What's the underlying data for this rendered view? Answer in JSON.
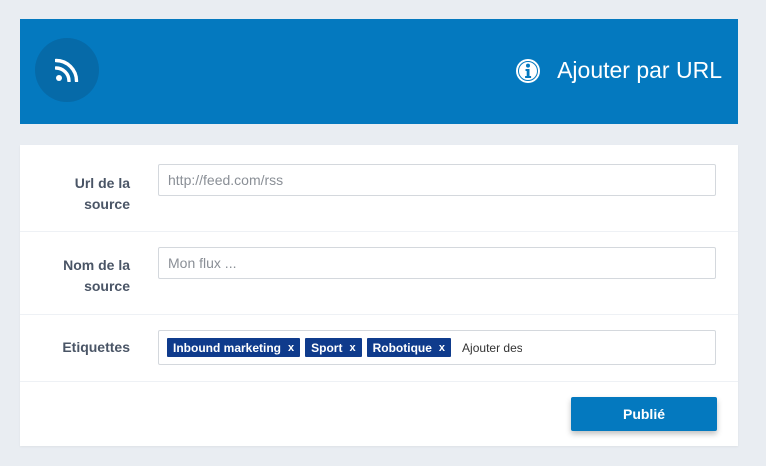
{
  "header": {
    "title": "Ajouter par URL",
    "icons": [
      "rss-icon",
      "info-icon"
    ],
    "bg_color": "#0479bf"
  },
  "form": {
    "url": {
      "label": "Url de la source",
      "placeholder": "http://feed.com/rss",
      "value": ""
    },
    "name": {
      "label": "Nom de la source",
      "placeholder": "Mon flux ...",
      "value": ""
    },
    "tags": {
      "label": "Etiquettes",
      "items": [
        "Inbound marketing",
        "Sport",
        "Robotique"
      ],
      "remove_glyph": "x",
      "placeholder": "Ajouter des",
      "tag_color": "#0f3b8c"
    },
    "submit_label": "Publié"
  }
}
